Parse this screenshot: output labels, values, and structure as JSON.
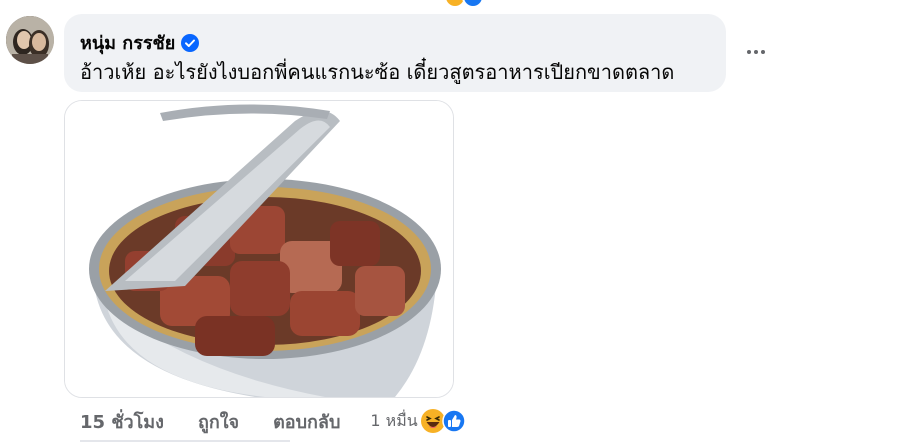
{
  "comment": {
    "author": "หนุ่ม กรรชัย",
    "verified_badge": "verified-check-icon",
    "text": "อ้าวเห้ย อะไรยังไงบอกพี่คนแรกนะซ้อ เดี๋ยวสูตรอาหารเปียกขาดตลาด",
    "more_icon": "more-dots-icon",
    "image": "opened-can-of-wet-food-photo"
  },
  "actions": {
    "timestamp": "15 ชั่วโมง",
    "like_label": "ถูกใจ",
    "reply_label": "ตอบกลับ",
    "reaction_count": "1 หมื่น",
    "reaction_icons": [
      "haha-icon",
      "like-icon"
    ]
  },
  "colors": {
    "bubble_bg": "#f0f2f5",
    "meta_text": "#65676b",
    "verified_blue": "#0866ff",
    "like_blue": "#1877f2",
    "haha_yellow": "#f7b125"
  }
}
